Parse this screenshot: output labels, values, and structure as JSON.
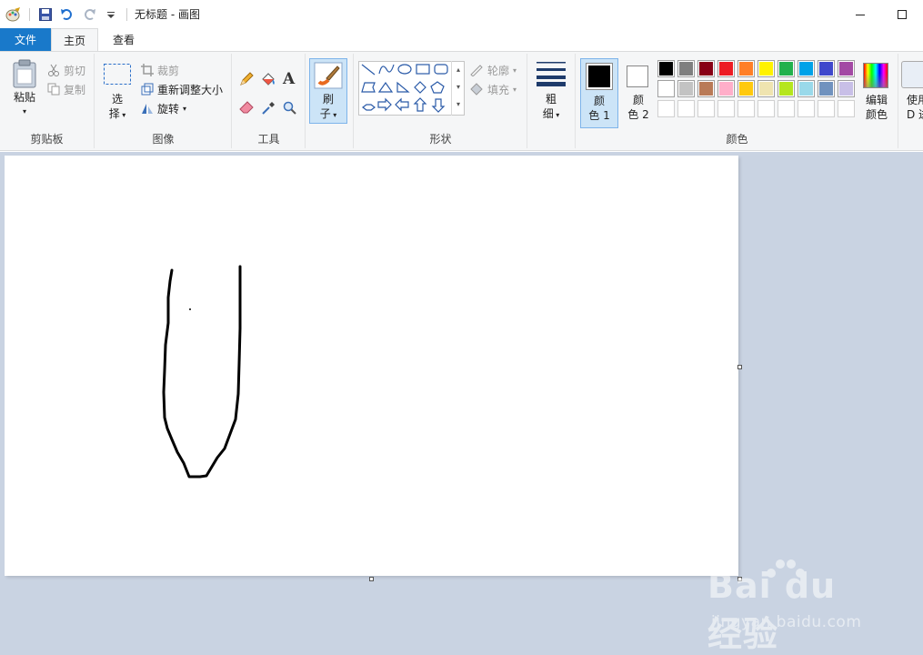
{
  "titlebar": {
    "title": "无标题 - 画图"
  },
  "tabs": [
    {
      "label": "文件"
    },
    {
      "label": "主页"
    },
    {
      "label": "查看"
    }
  ],
  "ribbon": {
    "clipboard": {
      "paste": "粘贴",
      "cut": "剪切",
      "copy": "复制",
      "group": "剪贴板"
    },
    "image": {
      "select_1": "选",
      "select_2": "择",
      "crop": "裁剪",
      "resize": "重新调整大小",
      "rotate": "旋转",
      "group": "图像"
    },
    "tools": {
      "group": "工具"
    },
    "brushes": {
      "label_1": "刷",
      "label_2": "子"
    },
    "shapes": {
      "outline": "轮廓",
      "fill": "填充",
      "group": "形状"
    },
    "size": {
      "label_1": "粗",
      "label_2": "细"
    },
    "colors": {
      "color1_1": "颜",
      "color1_2": "色 1",
      "color2_1": "颜",
      "color2_2": "色 2",
      "edit_1": "编辑",
      "edit_2": "颜色",
      "group": "颜色",
      "use3d_1": "使用",
      "use3d_2": "D 进",
      "color1_value": "#000000",
      "color2_value": "#ffffff",
      "palette_row1": [
        "#000000",
        "#7f7f7f",
        "#880015",
        "#ed1c24",
        "#ff7f27",
        "#fff200",
        "#22b14c",
        "#00a2e8",
        "#3f48cc",
        "#a349a4"
      ],
      "palette_row2": [
        "#ffffff",
        "#c3c3c3",
        "#b97a57",
        "#ffaec9",
        "#ffc90e",
        "#efe4b0",
        "#b5e61d",
        "#99d9ea",
        "#7092be",
        "#c8bfe7"
      ]
    }
  },
  "watermark": {
    "logo": "Bai du 经验",
    "url": "jingyan.baidu.com"
  }
}
